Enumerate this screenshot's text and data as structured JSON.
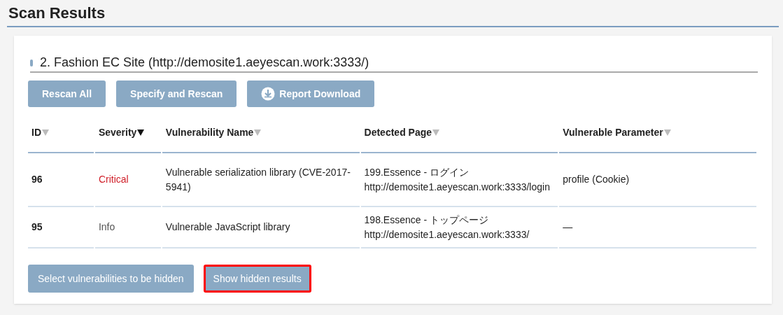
{
  "page": {
    "title": "Scan Results"
  },
  "section": {
    "title": "2. Fashion EC Site (http://demosite1.aeyescan.work:3333/)"
  },
  "actions": [
    {
      "label": "Rescan All",
      "kind": "plain"
    },
    {
      "label": "Specify and Rescan",
      "kind": "plain"
    },
    {
      "label": "Report Download",
      "kind": "download"
    }
  ],
  "table": {
    "columns": [
      {
        "label": "ID",
        "sorted": false
      },
      {
        "label": "Severity",
        "sorted": true
      },
      {
        "label": "Vulnerability Name",
        "sorted": false
      },
      {
        "label": "Detected Page",
        "sorted": false
      },
      {
        "label": "Vulnerable Parameter",
        "sorted": false
      }
    ],
    "rows": [
      {
        "id": "96",
        "severity": "Critical",
        "kind": "critical",
        "name": "Vulnerable serialization library (CVE-2017-5941)",
        "page_title": "199.Essence - ログイン",
        "page_url": "http://demosite1.aeyescan.work:3333/login",
        "parameter": "profile (Cookie)"
      },
      {
        "id": "95",
        "severity": "Info",
        "kind": "info",
        "name": "Vulnerable JavaScript library",
        "page_title": "198.Essence - トップページ",
        "page_url": "http://demosite1.aeyescan.work:3333/",
        "parameter": "—"
      }
    ]
  },
  "footer_buttons": [
    {
      "label": "Select vulnerabilities to be hidden",
      "highlighted": false
    },
    {
      "label": "Show hidden results",
      "highlighted": true
    }
  ]
}
